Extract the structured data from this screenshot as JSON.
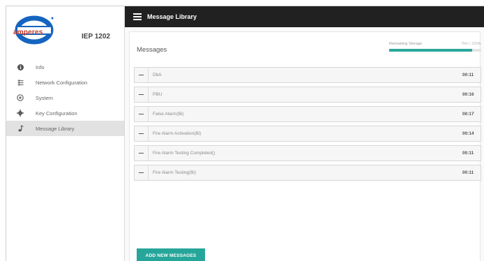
{
  "brand": {
    "logo_text": "amperes",
    "device_name": "IEP 1202"
  },
  "sidebar": {
    "items": [
      {
        "label": "Info",
        "icon": "info-icon"
      },
      {
        "label": "Network Configuration",
        "icon": "network-icon"
      },
      {
        "label": "System",
        "icon": "system-icon"
      },
      {
        "label": "Key Configuration",
        "icon": "gear-icon"
      },
      {
        "label": "Message Library",
        "icon": "music-note-icon"
      }
    ],
    "active_index": 4
  },
  "header": {
    "title": "Message Library"
  },
  "main": {
    "section_title": "Messages",
    "storage": {
      "label": "Remaining Storage",
      "value_text": "7Mn / 32Mb",
      "fill_fraction": 0.9
    },
    "messages": [
      {
        "name": "DbA",
        "duration": "00:11"
      },
      {
        "name": "PBU",
        "duration": "00:16"
      },
      {
        "name": "False Alarm(Bi)",
        "duration": "00:17"
      },
      {
        "name": "Fire Alarm Activation(Bi)",
        "duration": "00:14"
      },
      {
        "name": "Fire Alarm Testing Completed()",
        "duration": "00:11"
      },
      {
        "name": "Fire Alarm Testing(Bi)",
        "duration": "00:11"
      }
    ],
    "add_button_label": "ADD NEW MESSAGES"
  },
  "colors": {
    "topbar": "#212121",
    "accent": "#26a69a",
    "active_nav": "#e2e2e2",
    "logo_blue": "#1565c0",
    "logo_red": "#c0392b"
  }
}
